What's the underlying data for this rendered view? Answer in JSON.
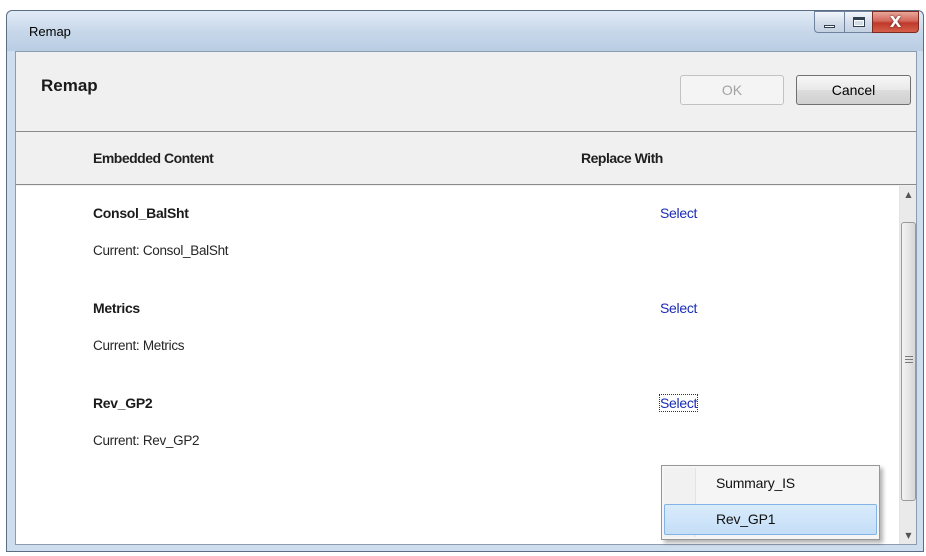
{
  "window": {
    "title": "Remap",
    "controls": {
      "minimize_icon": "minimize-icon",
      "maximize_icon": "maximize-icon",
      "close_icon": "close-icon",
      "close_glyph": "X"
    }
  },
  "header": {
    "title": "Remap",
    "ok_label": "OK",
    "ok_enabled": false,
    "cancel_label": "Cancel"
  },
  "columns": {
    "embedded": "Embedded Content",
    "replace": "Replace With"
  },
  "items": [
    {
      "name": "Consol_BalSht",
      "current": "Current: Consol_BalSht",
      "action": "Select"
    },
    {
      "name": "Metrics",
      "current": "Current: Metrics",
      "action": "Select"
    },
    {
      "name": "Rev_GP2",
      "current": "Current: Rev_GP2",
      "action": "Select"
    }
  ],
  "dropdown": {
    "options": [
      "Summary_IS",
      "Rev_GP1"
    ],
    "highlighted": "Rev_GP1"
  },
  "colors": {
    "link": "#1a2bb6",
    "highlight": "#c4def7",
    "highlight_border": "#84b3e8"
  }
}
